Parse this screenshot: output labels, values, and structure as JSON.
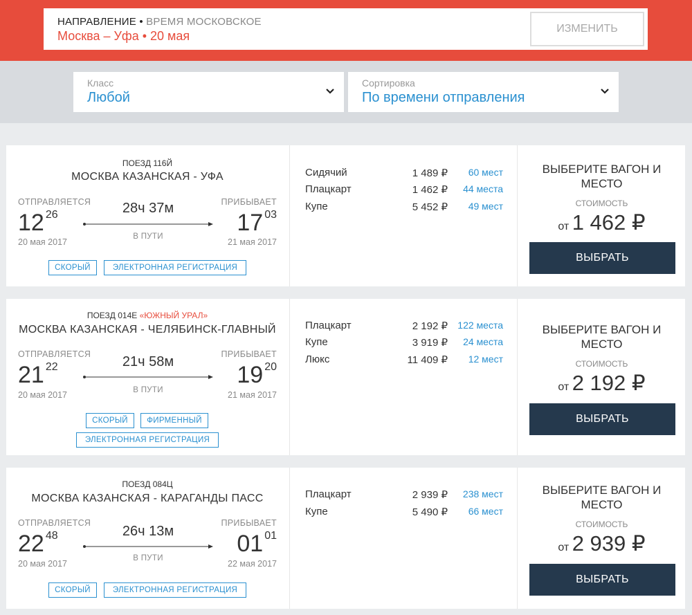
{
  "header": {
    "direction_label": "НАПРАВЛЕНИЕ",
    "separator": "•",
    "timezone_note": "ВРЕМЯ МОСКОВСКОЕ",
    "route": "Москва – Уфа • 20 мая",
    "change_label": "ИЗМЕНИТЬ"
  },
  "filters": {
    "class_label": "Класс",
    "class_value": "Любой",
    "sort_label": "Сортировка",
    "sort_value": "По времени отправления"
  },
  "labels": {
    "departs": "ОТПРАВЛЯЕТСЯ",
    "arrives": "ПРИБЫВАЕТ",
    "en_route": "В ПУТИ",
    "choose": "ВЫБЕРИТЕ ВАГОН И МЕСТО",
    "cost": "СТОИМОСТЬ",
    "from": "от",
    "select_button": "ВЫБРАТЬ"
  },
  "trains": [
    {
      "number": "ПОЕЗД 116Й",
      "name": "",
      "route": "МОСКВА КАЗАНСКАЯ - УФА",
      "dep_hour": "12",
      "dep_min": "26",
      "dep_date": "20 мая 2017",
      "duration": "28ч 37м",
      "arr_hour": "17",
      "arr_min": "03",
      "arr_date": "21 мая 2017",
      "tags": [
        "СКОРЫЙ",
        "ЭЛЕКТРОННАЯ РЕГИСТРАЦИЯ"
      ],
      "seats": [
        {
          "type": "Сидячий",
          "price": "1 489 ₽",
          "count": "60 мест"
        },
        {
          "type": "Плацкарт",
          "price": "1 462 ₽",
          "count": "44 места"
        },
        {
          "type": "Купе",
          "price": "5 452 ₽",
          "count": "49 мест"
        }
      ],
      "min_price": "1 462 ₽"
    },
    {
      "number": "ПОЕЗД 014Е",
      "name": "«ЮЖНЫЙ УРАЛ»",
      "route": "МОСКВА КАЗАНСКАЯ - ЧЕЛЯБИНСК-ГЛАВНЫЙ",
      "dep_hour": "21",
      "dep_min": "22",
      "dep_date": "20 мая 2017",
      "duration": "21ч 58м",
      "arr_hour": "19",
      "arr_min": "20",
      "arr_date": "21 мая 2017",
      "tags": [
        "СКОРЫЙ",
        "ФИРМЕННЫЙ",
        "ЭЛЕКТРОННАЯ РЕГИСТРАЦИЯ"
      ],
      "seats": [
        {
          "type": "Плацкарт",
          "price": "2 192 ₽",
          "count": "122 места"
        },
        {
          "type": "Купе",
          "price": "3 919 ₽",
          "count": "24 места"
        },
        {
          "type": "Люкс",
          "price": "11 409 ₽",
          "count": "12 мест"
        }
      ],
      "min_price": "2 192 ₽"
    },
    {
      "number": "ПОЕЗД 084Ц",
      "name": "",
      "route": "МОСКВА КАЗАНСКАЯ - КАРАГАНДЫ ПАСС",
      "dep_hour": "22",
      "dep_min": "48",
      "dep_date": "20 мая 2017",
      "duration": "26ч 13м",
      "arr_hour": "01",
      "arr_min": "01",
      "arr_date": "22 мая 2017",
      "tags": [
        "СКОРЫЙ",
        "ЭЛЕКТРОННАЯ РЕГИСТРАЦИЯ"
      ],
      "seats": [
        {
          "type": "Плацкарт",
          "price": "2 939 ₽",
          "count": "238 мест"
        },
        {
          "type": "Купе",
          "price": "5 490 ₽",
          "count": "66 мест"
        }
      ],
      "min_price": "2 939 ₽"
    }
  ],
  "colors": {
    "accent_red": "#e74c3c",
    "link_blue": "#2a90d0",
    "button_dark": "#25394d"
  }
}
